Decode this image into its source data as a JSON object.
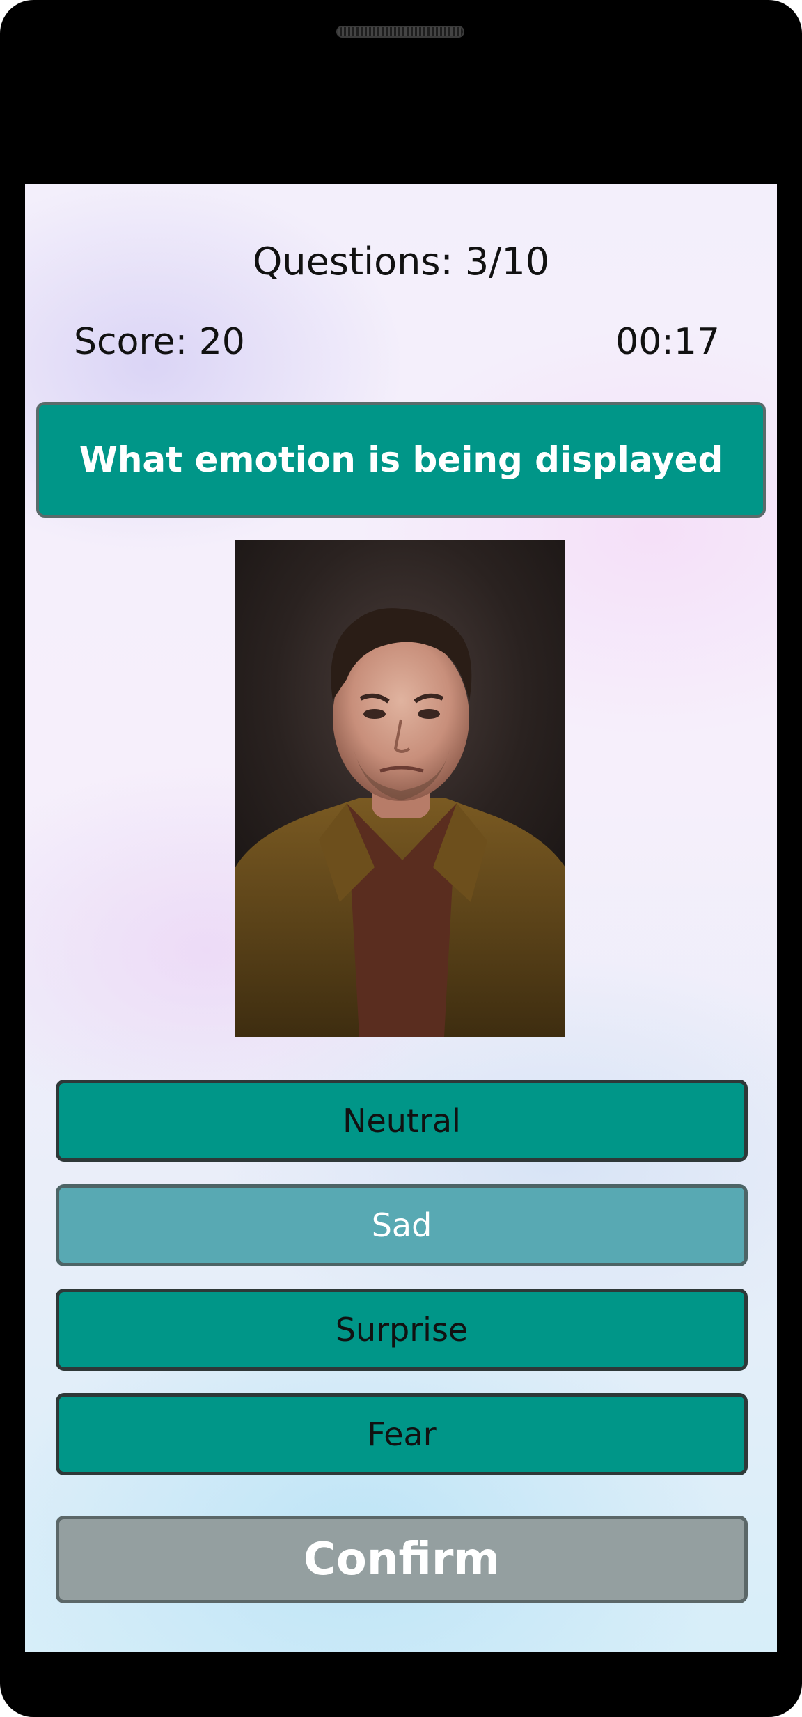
{
  "quiz": {
    "progress_text": "Questions: 3/10",
    "score_text": "Score: 20",
    "timer_text": "00:17",
    "question_text": "What emotion is being displayed",
    "answers": [
      {
        "label": "Neutral",
        "selected": false
      },
      {
        "label": "Sad",
        "selected": true
      },
      {
        "label": "Surprise",
        "selected": false
      },
      {
        "label": "Fear",
        "selected": false
      }
    ],
    "confirm_label": "Confirm"
  },
  "colors": {
    "accent": "#009688",
    "selected_answer": "#58a9b3",
    "confirm_disabled": "#949fa0",
    "device_bezel": "#000000"
  },
  "icons": {
    "speaker": "speaker-grille-icon"
  }
}
